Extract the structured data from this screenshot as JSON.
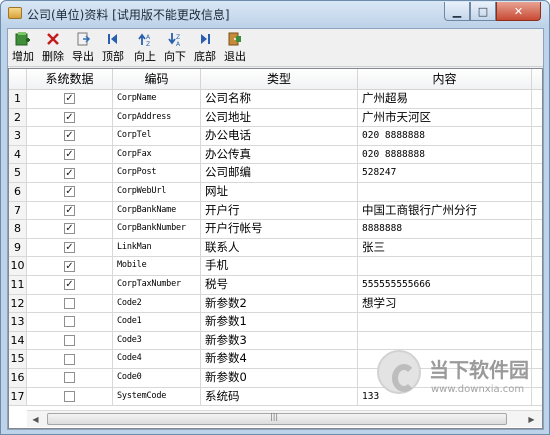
{
  "window": {
    "title": "公司(单位)资料  [试用版不能更改信息]",
    "min_symbol": "▁",
    "max_symbol": "□",
    "close_symbol": "✕"
  },
  "toolbar": [
    {
      "label": "增加",
      "icon": "add-icon"
    },
    {
      "label": "删除",
      "icon": "delete-icon"
    },
    {
      "label": "导出",
      "icon": "export-icon"
    },
    {
      "label": "顶部",
      "icon": "first-icon"
    },
    {
      "label": "向上",
      "icon": "up-icon"
    },
    {
      "label": "向下",
      "icon": "down-icon"
    },
    {
      "label": "底部",
      "icon": "last-icon"
    },
    {
      "label": "退出",
      "icon": "exit-icon"
    }
  ],
  "grid": {
    "columns": [
      "系统数据",
      "编码",
      "类型",
      "内容"
    ],
    "rows": [
      {
        "num": "1",
        "system": true,
        "code": "CorpName",
        "type": "公司名称",
        "content": "广州超易"
      },
      {
        "num": "2",
        "system": true,
        "code": "CorpAddress",
        "type": "公司地址",
        "content": "广州市天河区"
      },
      {
        "num": "3",
        "system": true,
        "code": "CorpTel",
        "type": "办公电话",
        "content": "020 8888888"
      },
      {
        "num": "4",
        "system": true,
        "code": "CorpFax",
        "type": "办公传真",
        "content": "020 8888888"
      },
      {
        "num": "5",
        "system": true,
        "code": "CorpPost",
        "type": "公司邮编",
        "content": "528247"
      },
      {
        "num": "6",
        "system": true,
        "code": "CorpWebUrl",
        "type": "网址",
        "content": ""
      },
      {
        "num": "7",
        "system": true,
        "code": "CorpBankName",
        "type": "开户行",
        "content": "中国工商银行广州分行"
      },
      {
        "num": "8",
        "system": true,
        "code": "CorpBankNumber",
        "type": "开户行帐号",
        "content": "8888888"
      },
      {
        "num": "9",
        "system": true,
        "code": "LinkMan",
        "type": "联系人",
        "content": "张三"
      },
      {
        "num": "10",
        "system": true,
        "code": "Mobile",
        "type": "手机",
        "content": ""
      },
      {
        "num": "11",
        "system": true,
        "code": "CorpTaxNumber",
        "type": "税号",
        "content": "555555555666"
      },
      {
        "num": "12",
        "system": false,
        "code": "Code2",
        "type": "新参数2",
        "content": "想学习"
      },
      {
        "num": "13",
        "system": false,
        "code": "Code1",
        "type": "新参数1",
        "content": ""
      },
      {
        "num": "14",
        "system": false,
        "code": "Code3",
        "type": "新参数3",
        "content": ""
      },
      {
        "num": "15",
        "system": false,
        "code": "Code4",
        "type": "新参数4",
        "content": ""
      },
      {
        "num": "16",
        "system": false,
        "code": "Code0",
        "type": "新参数0",
        "content": ""
      },
      {
        "num": "17",
        "system": false,
        "code": "SystemCode",
        "type": "系统码",
        "content": "133"
      }
    ]
  },
  "scrollbar": {
    "left_arrow": "◀",
    "right_arrow": "▶",
    "grip": "|||"
  },
  "watermark": {
    "name": "当下软件园",
    "url": "www.downxia.com"
  }
}
